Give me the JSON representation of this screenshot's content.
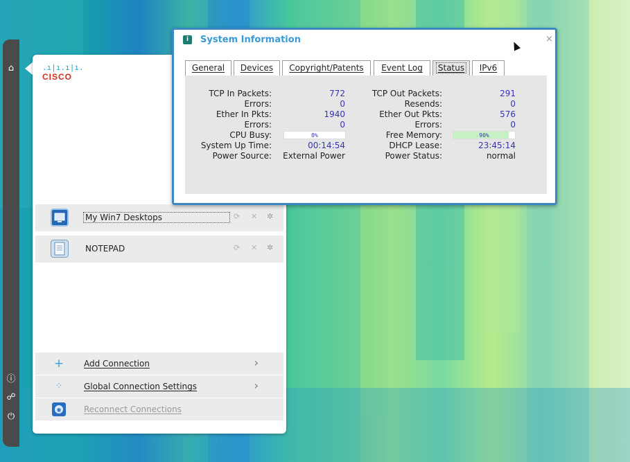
{
  "colors": {
    "accent": "#3a88c4",
    "title": "#3a9ad5",
    "value": "#3535b0",
    "panel_row": "#ebebeb",
    "cisco_blue": "#1ba0d7",
    "cisco_red": "#d52b1e",
    "memory_fill": "#c7f1c3"
  },
  "rail": {
    "icons": [
      "home-icon",
      "info-icon",
      "share-icon",
      "power-icon"
    ]
  },
  "launcher": {
    "logo": {
      "bars": ".ı|ı.ı|ı.",
      "text": "CISCO"
    },
    "connections": [
      {
        "label": "My Win7 Desktops",
        "icon": "remote-desktop-icon",
        "controls": [
          "refresh-icon",
          "close-icon",
          "gear-icon"
        ]
      },
      {
        "label": "NOTEPAD",
        "icon": "notepad-icon",
        "controls": [
          "refresh-icon",
          "close-icon",
          "gear-icon"
        ]
      }
    ],
    "actions": [
      {
        "label": "Add Connection",
        "icon": "plus-icon",
        "has_chevron": true,
        "enabled": true
      },
      {
        "label": "Global Connection Settings",
        "icon": "settings-icon",
        "has_chevron": true,
        "enabled": true
      },
      {
        "label": "Reconnect Connections",
        "icon": "reconnect-icon",
        "has_chevron": false,
        "enabled": false
      }
    ]
  },
  "dialog": {
    "title": "System Information",
    "close_glyph": "×",
    "tabs": [
      "General",
      "Devices",
      "Copyright/Patents",
      "Event Log",
      "Status",
      "IPv6"
    ],
    "active_tab": "Status",
    "left": [
      {
        "label": "TCP In Packets:",
        "value": "772"
      },
      {
        "label": "Errors:",
        "value": "0"
      },
      {
        "label": "Ether In Pkts:",
        "value": "1940"
      },
      {
        "label": "Errors:",
        "value": "0"
      },
      {
        "label": "CPU Busy:",
        "value": "0%",
        "bar": true,
        "percent": 0
      },
      {
        "label": "System Up Time:",
        "value": "00:14:54"
      },
      {
        "label": "Power Source:",
        "value": "External Power"
      }
    ],
    "right": [
      {
        "label": "TCP Out Packets:",
        "value": "291"
      },
      {
        "label": "Resends:",
        "value": "0"
      },
      {
        "label": "Ether Out Pkts:",
        "value": "576"
      },
      {
        "label": "Errors:",
        "value": "0"
      },
      {
        "label": "Free Memory:",
        "value": "90%",
        "bar": true,
        "percent": 90
      },
      {
        "label": "DHCP Lease:",
        "value": "23:45:14"
      },
      {
        "label": "Power Status:",
        "value": "normal"
      }
    ]
  }
}
